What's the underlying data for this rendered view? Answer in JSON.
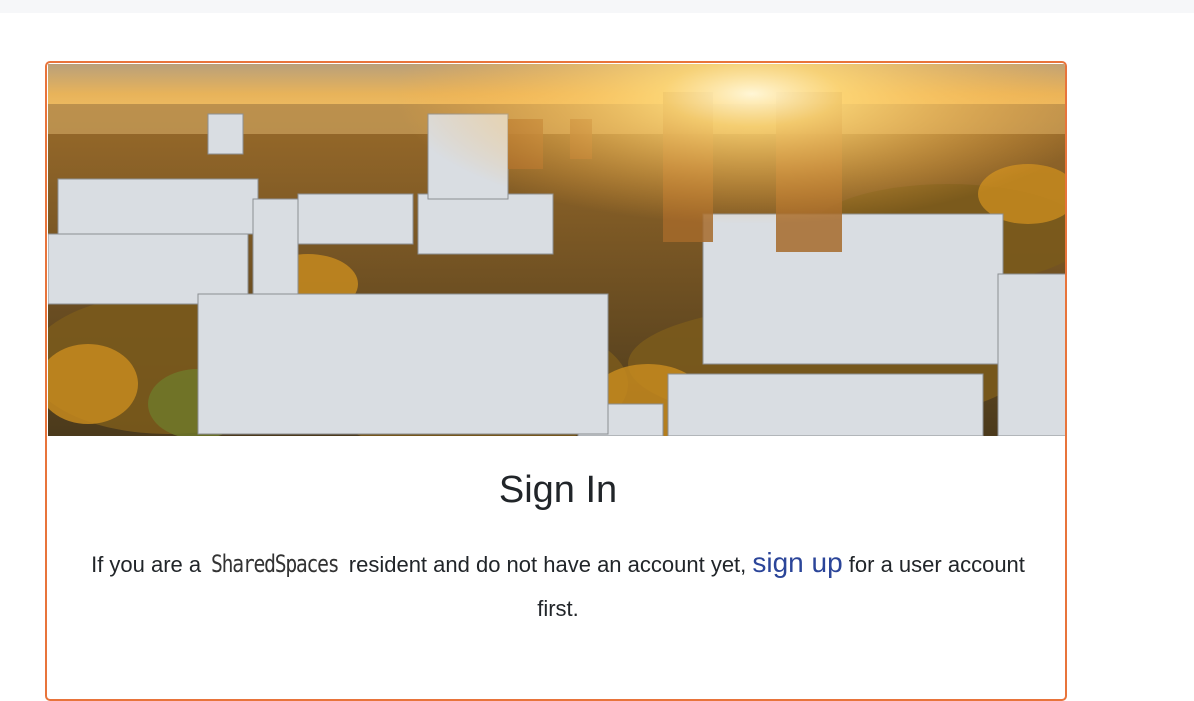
{
  "card": {
    "hero_image": "city-sunset-aerial-image",
    "accent_color": "#e8743b"
  },
  "signin": {
    "title": "Sign In",
    "intro_before": "If you are a ",
    "brand": "SharedSpaces",
    "intro_middle": " resident and do not have an account yet, ",
    "signup_link": "sign up",
    "intro_after": " for a user account first.",
    "link_color": "#2b4599"
  }
}
